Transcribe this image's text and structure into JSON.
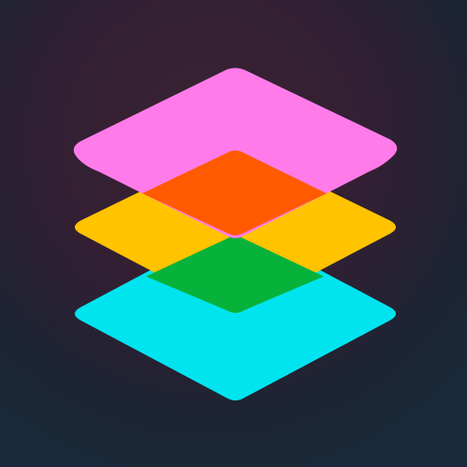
{
  "icon": {
    "name": "stacked-layers-app-icon",
    "colors": {
      "background_center": "#3a2332",
      "background_top": "#331f33",
      "background_edge": "#1c2433",
      "background_bottom": "#1a2a3a",
      "top_layer": "#ff7bea",
      "middle_layer": "#ffc300",
      "bottom_layer": "#00e4ef",
      "overlap_top_middle": "#ff5a00",
      "overlap_middle_bottom": "#06b23a"
    }
  }
}
